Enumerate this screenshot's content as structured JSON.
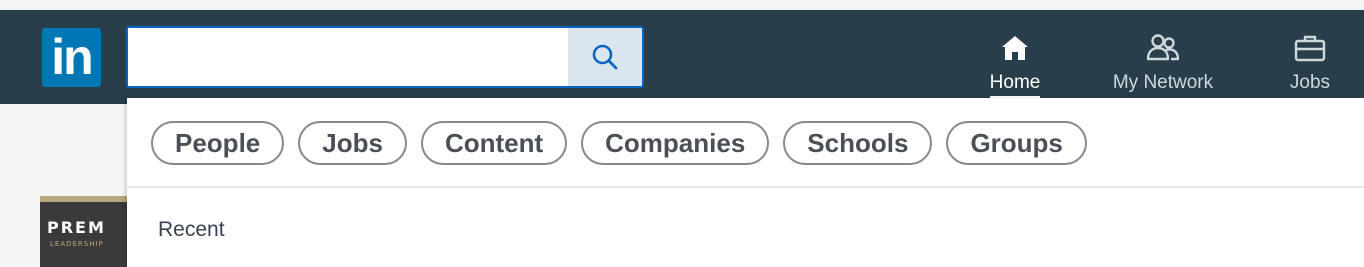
{
  "brand": {
    "logo_text": "in"
  },
  "search": {
    "value": "",
    "placeholder": "",
    "button_icon": "search-icon"
  },
  "nav": {
    "items": [
      {
        "label": "Home",
        "icon": "home-icon",
        "active": true
      },
      {
        "label": "My Network",
        "icon": "people-icon",
        "active": false
      },
      {
        "label": "Jobs",
        "icon": "briefcase-icon",
        "active": false
      }
    ]
  },
  "filters": {
    "chips": [
      "People",
      "Jobs",
      "Content",
      "Companies",
      "Schools",
      "Groups"
    ]
  },
  "dropdown": {
    "recent_label": "Recent"
  },
  "thumbnail": {
    "line1": "PREM",
    "line2": "LEADERSHIP"
  },
  "colors": {
    "topbar": "#283e4a",
    "accent": "#0077b5"
  }
}
